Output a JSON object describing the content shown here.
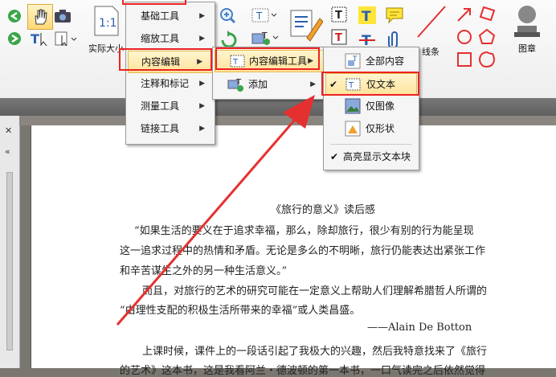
{
  "ribbon": {
    "actual_size_label": "实际大小",
    "line_label": "线条",
    "stamp_label": "图章"
  },
  "menu1": {
    "items": [
      {
        "label": "基础工具"
      },
      {
        "label": "缩放工具"
      },
      {
        "label": "内容编辑"
      },
      {
        "label": "注释和标记"
      },
      {
        "label": "测量工具"
      },
      {
        "label": "链接工具"
      }
    ]
  },
  "menu2": {
    "items": [
      {
        "label": "内容编辑工具"
      },
      {
        "label": "添加"
      }
    ]
  },
  "menu3": {
    "items": [
      {
        "label": "全部内容"
      },
      {
        "label": "仅文本"
      },
      {
        "label": "仅图像"
      },
      {
        "label": "仅形状"
      },
      {
        "label": "高亮显示文本块"
      }
    ]
  },
  "document": {
    "title": "《旅行的意义》读后感",
    "lines": [
      "“如果生活的要义在于追求幸福，那么，除却旅行，很少有别的行为能呈现",
      "这一追求过程中的热情和矛盾。无论是多么的不明晰，旅行仍能表达出紧张工作",
      "和辛苦谋生之外的另一种生活意义。”",
      "而且，对旅行的艺术的研究可能在一定意义上帮助人们理解希腊哲人所谓的",
      "“由理性支配的积极生活所带来的幸福”或人类昌盛。",
      "——Alain De Botton",
      "上课时候，课件上的一段话引起了我极大的兴趣，然后我特意找来了《旅行",
      "的艺术》这本书，这是我看阿兰・德波顿的第一本书，一口气读完之后依然觉得"
    ]
  },
  "colors": {
    "accent_red": "#e53030",
    "menu_highlight": "#ffe39a"
  }
}
